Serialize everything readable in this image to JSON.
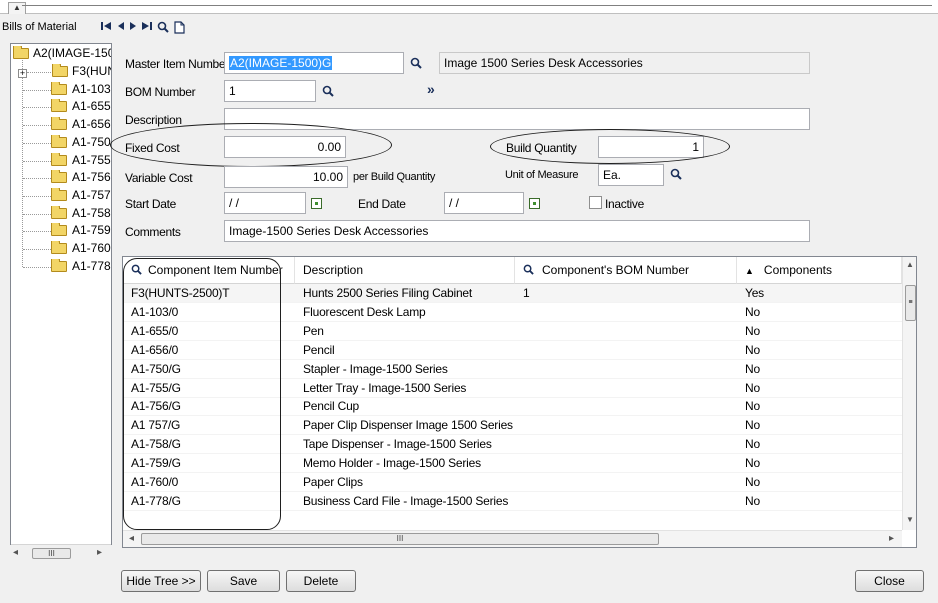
{
  "window": {
    "title": "Bills of Material"
  },
  "toolbar": {
    "nav_icons": [
      "first-record-icon",
      "previous-record-icon",
      "next-record-icon",
      "last-record-icon",
      "search-icon",
      "new-document-icon"
    ]
  },
  "tree": {
    "root": "A2(IMAGE-1500",
    "items": [
      "F3(HUN",
      "A1-103",
      "A1-655",
      "A1-656",
      "A1-750",
      "A1-755",
      "A1-756",
      "A1-757",
      "A1-758",
      "A1-759",
      "A1-760",
      "A1-778"
    ],
    "scroll_label": "III"
  },
  "form": {
    "master_item_label": "Master Item Number",
    "master_item_value": "A2(IMAGE-1500)G",
    "master_item_desc": "Image 1500 Series Desk Accessories",
    "bom_number_label": "BOM Number",
    "bom_number_value": "1",
    "description_label": "Description",
    "description_value": "",
    "fixed_cost_label": "Fixed Cost",
    "fixed_cost_value": "0.00",
    "build_quantity_label": "Build Quantity",
    "build_quantity_value": "1",
    "variable_cost_label": "Variable Cost",
    "variable_cost_value": "10.00",
    "per_build_label": "per Build Quantity",
    "uom_label": "Unit of Measure",
    "uom_value": "Ea.",
    "start_date_label": "Start Date",
    "start_date_value": "/ /",
    "end_date_label": "End Date",
    "end_date_value": "/ /",
    "inactive_label": "Inactive",
    "comments_label": "Comments",
    "comments_value": "Image-1500 Series Desk Accessories"
  },
  "grid": {
    "columns": [
      "Component Item Number",
      "Description",
      "Component's BOM Number",
      "Components"
    ],
    "rows": [
      {
        "item": "F3(HUNTS-2500)T",
        "desc": "Hunts 2500 Series Filing Cabinet",
        "bom": "1",
        "comp": "Yes"
      },
      {
        "item": "A1-103/0",
        "desc": "Fluorescent Desk Lamp",
        "bom": "",
        "comp": "No"
      },
      {
        "item": "A1-655/0",
        "desc": "Pen",
        "bom": "",
        "comp": "No"
      },
      {
        "item": "A1-656/0",
        "desc": "Pencil",
        "bom": "",
        "comp": "No"
      },
      {
        "item": "A1-750/G",
        "desc": "Stapler - Image-1500 Series",
        "bom": "",
        "comp": "No"
      },
      {
        "item": "A1-755/G",
        "desc": "Letter Tray - Image-1500 Series",
        "bom": "",
        "comp": "No"
      },
      {
        "item": "A1-756/G",
        "desc": "Pencil Cup",
        "bom": "",
        "comp": "No"
      },
      {
        "item": "A1 757/G",
        "desc": "Paper Clip Dispenser  Image 1500 Series",
        "bom": "",
        "comp": "No"
      },
      {
        "item": "A1-758/G",
        "desc": "Tape Dispenser - Image-1500 Series",
        "bom": "",
        "comp": "No"
      },
      {
        "item": "A1-759/G",
        "desc": "Memo Holder - Image-1500 Series",
        "bom": "",
        "comp": "No"
      },
      {
        "item": "A1-760/0",
        "desc": "Paper Clips",
        "bom": "",
        "comp": "No"
      },
      {
        "item": "A1-778/G",
        "desc": "Business Card File - Image-1500 Series",
        "bom": "",
        "comp": "No"
      }
    ],
    "hscroll_label": "III"
  },
  "buttons": {
    "hide_tree": "Hide Tree >>",
    "save": "Save",
    "delete": "Delete",
    "close": "Close"
  },
  "colors": {
    "selection": "#3399ff",
    "nav_icon": "#1a2f5a",
    "folder": "#f2d566",
    "date_icon": "#3f8f2f"
  }
}
